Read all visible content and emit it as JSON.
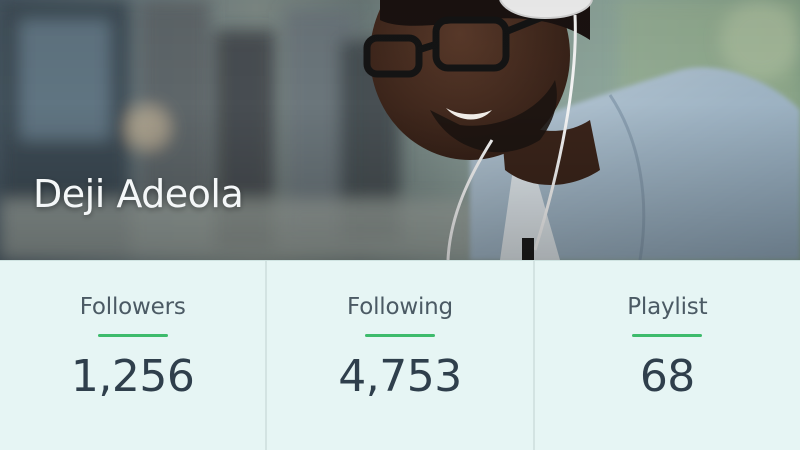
{
  "profile": {
    "name": "Deji Adeola"
  },
  "stats": [
    {
      "label": "Followers",
      "value": "1,256"
    },
    {
      "label": "Following",
      "value": "4,753"
    },
    {
      "label": "Playlist",
      "value": "68"
    }
  ],
  "colors": {
    "accent": "#3dbb6c",
    "panel_background": "#e6f5f4",
    "label_text": "#4b5a64",
    "value_text": "#2f3f4c"
  },
  "icons": [
    "headphones"
  ]
}
